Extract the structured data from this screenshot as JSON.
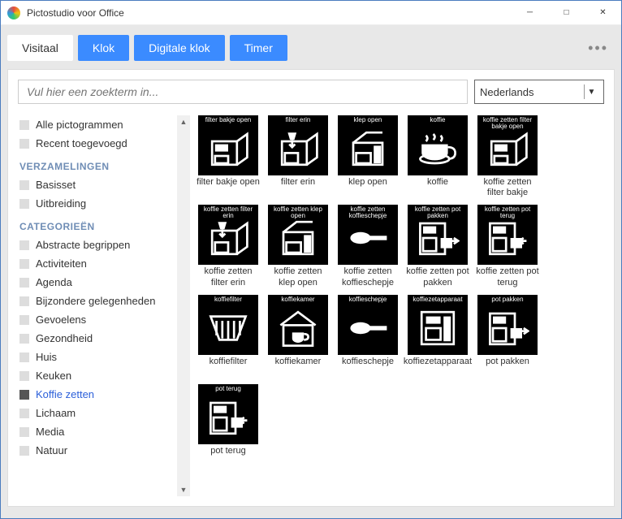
{
  "window": {
    "title": "Pictostudio voor Office"
  },
  "tabs": [
    {
      "label": "Visitaal",
      "active": true
    },
    {
      "label": "Klok",
      "active": false
    },
    {
      "label": "Digitale klok",
      "active": false
    },
    {
      "label": "Timer",
      "active": false
    }
  ],
  "search": {
    "placeholder": "Vul hier een zoekterm in..."
  },
  "language": {
    "selected": "Nederlands"
  },
  "sidebar": {
    "top": [
      {
        "label": "Alle pictogrammen",
        "selected": false
      },
      {
        "label": "Recent toegevoegd",
        "selected": false
      }
    ],
    "header_collections": "VERZAMELINGEN",
    "collections": [
      {
        "label": "Basisset",
        "selected": false
      },
      {
        "label": "Uitbreiding",
        "selected": false
      }
    ],
    "header_categories": "CATEGORIEËN",
    "categories": [
      {
        "label": "Abstracte begrippen",
        "selected": false
      },
      {
        "label": "Activiteiten",
        "selected": false
      },
      {
        "label": "Agenda",
        "selected": false
      },
      {
        "label": "Bijzondere gelegenheden",
        "selected": false
      },
      {
        "label": "Gevoelens",
        "selected": false
      },
      {
        "label": "Gezondheid",
        "selected": false
      },
      {
        "label": "Huis",
        "selected": false
      },
      {
        "label": "Keuken",
        "selected": false
      },
      {
        "label": "Koffie zetten",
        "selected": true
      },
      {
        "label": "Lichaam",
        "selected": false
      },
      {
        "label": "Media",
        "selected": false
      },
      {
        "label": "Natuur",
        "selected": false
      }
    ]
  },
  "pictograms": [
    {
      "caption": "filter bakje open",
      "label": "filter bakje open",
      "icon": "machine-open"
    },
    {
      "caption": "filter erin",
      "label": "filter erin",
      "icon": "machine-filter-in"
    },
    {
      "caption": "klep open",
      "label": "klep open",
      "icon": "machine-lid"
    },
    {
      "caption": "koffie",
      "label": "koffie",
      "icon": "cup"
    },
    {
      "caption": "koffie zetten filter bakje open",
      "label": "koffie zetten filter bakje",
      "icon": "machine-open"
    },
    {
      "caption": "koffie zetten filter erin",
      "label": "koffie zetten filter erin",
      "icon": "machine-filter-in"
    },
    {
      "caption": "koffie zetten klep open",
      "label": "koffie zetten klep open",
      "icon": "machine-lid"
    },
    {
      "caption": "koffie zetten koffieschepje",
      "label": "koffie zetten koffieschepje",
      "icon": "scoop"
    },
    {
      "caption": "koffie zetten pot pakken",
      "label": "koffie zetten pot pakken",
      "icon": "machine-pot-out"
    },
    {
      "caption": "koffie zetten pot terug",
      "label": "koffie zetten pot terug",
      "icon": "machine-pot-in"
    },
    {
      "caption": "koffiefilter",
      "label": "koffiefilter",
      "icon": "filter"
    },
    {
      "caption": "koffiekamer",
      "label": "koffiekamer",
      "icon": "room"
    },
    {
      "caption": "koffieschepje",
      "label": "koffieschepje",
      "icon": "scoop"
    },
    {
      "caption": "koffiezetapparaat",
      "label": "koffiezetapparaat",
      "icon": "machine"
    },
    {
      "caption": "pot pakken",
      "label": "pot pakken",
      "icon": "machine-pot-out"
    },
    {
      "caption": "pot terug",
      "label": "pot terug",
      "icon": "machine-pot-in"
    }
  ]
}
